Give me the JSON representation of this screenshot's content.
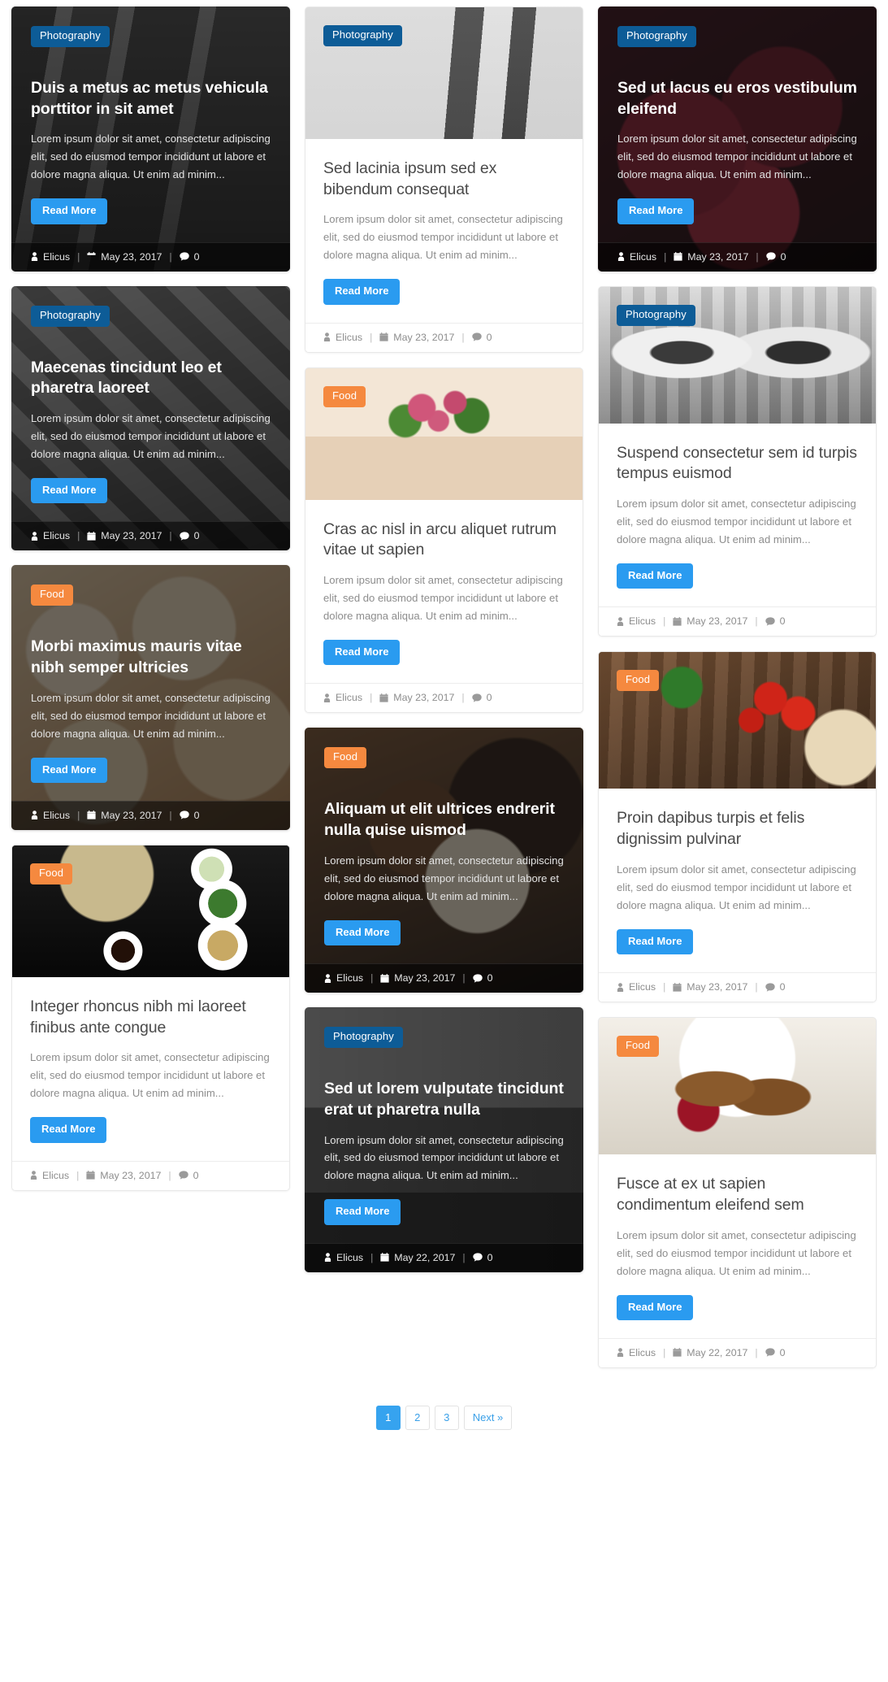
{
  "badges": {
    "photography": "Photography",
    "food": "Food",
    "photography_color": "#0d5c97",
    "food_color": "#f5893f"
  },
  "common": {
    "read_more": "Read More",
    "excerpt": "Lorem ipsum dolor sit amet, consectetur adipiscing elit, sed do eiusmod tempor incididunt ut labore et dolore magna aliqua. Ut enim ad minim...",
    "author": "Elicus",
    "comments": "0",
    "separator": "|",
    "accent_color": "#2a9bf0"
  },
  "columns": [
    {
      "cards": [
        {
          "style": "dark",
          "category": "Photography",
          "title": "Duis a metus ac metus vehicula porttitor in sit amet",
          "date": "May 23, 2017"
        },
        {
          "style": "dark",
          "category": "Photography",
          "title": "Maecenas tincidunt leo et pharetra laoreet",
          "date": "May 23, 2017"
        },
        {
          "style": "dark",
          "category": "Food",
          "title": "Morbi maximus mauris vitae nibh semper ultricies",
          "date": "May 23, 2017"
        },
        {
          "style": "light",
          "category": "Food",
          "title": "Integer rhoncus nibh mi laoreet finibus ante congue",
          "date": "May 23, 2017"
        }
      ]
    },
    {
      "cards": [
        {
          "style": "light",
          "category": "Photography",
          "title": "Sed lacinia ipsum sed ex bibendum consequat",
          "date": "May 23, 2017"
        },
        {
          "style": "light",
          "category": "Food",
          "title": "Cras ac nisl in arcu aliquet rutrum vitae ut sapien",
          "date": "May 23, 2017"
        },
        {
          "style": "dark",
          "category": "Food",
          "title": "Aliquam ut elit ultrices endrerit nulla quise uismod",
          "date": "May 23, 2017"
        },
        {
          "style": "dark",
          "category": "Photography",
          "title": "Sed ut lorem vulputate tincidunt erat ut pharetra nulla",
          "date": "May 22, 2017"
        }
      ]
    },
    {
      "cards": [
        {
          "style": "dark",
          "category": "Photography",
          "title": "Sed ut lacus eu eros vestibulum eleifend",
          "date": "May 23, 2017"
        },
        {
          "style": "light",
          "category": "Photography",
          "title": "Suspend consectetur sem id turpis tempus euismod",
          "date": "May 23, 2017"
        },
        {
          "style": "light",
          "category": "Food",
          "title": "Proin dapibus turpis et felis dignissim pulvinar",
          "date": "May 23, 2017"
        },
        {
          "style": "light",
          "category": "Food",
          "title": "Fusce at ex ut sapien condimentum eleifend sem",
          "date": "May 22, 2017"
        }
      ]
    }
  ],
  "pagination": {
    "items": [
      {
        "label": "1",
        "active": true
      },
      {
        "label": "2",
        "active": false
      },
      {
        "label": "3",
        "active": false
      },
      {
        "label": "Next »",
        "active": false
      }
    ]
  }
}
